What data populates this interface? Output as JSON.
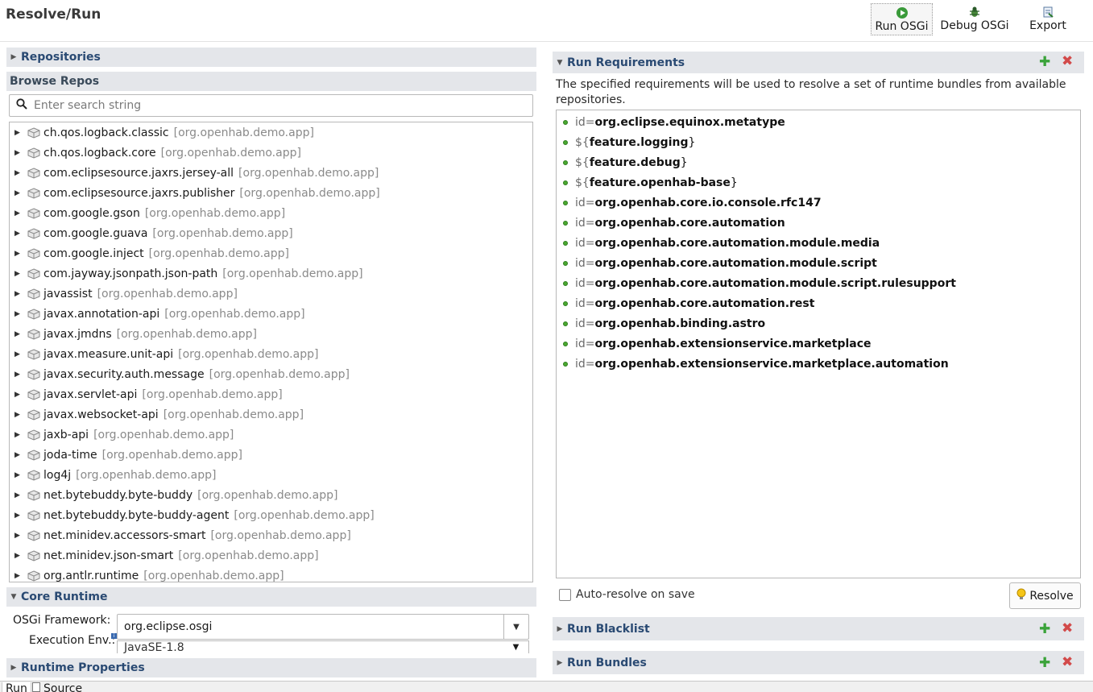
{
  "page": {
    "title": "Resolve/Run"
  },
  "toolbar": {
    "run_label": "Run OSGi",
    "debug_label": "Debug OSGi",
    "export_label": "Export"
  },
  "left": {
    "repositories_label": "Repositories",
    "browse_label": "Browse Repos",
    "search_placeholder": "Enter search string",
    "bundles": [
      {
        "name": "ch.qos.logback.classic",
        "source": "[org.openhab.demo.app]"
      },
      {
        "name": "ch.qos.logback.core",
        "source": "[org.openhab.demo.app]"
      },
      {
        "name": "com.eclipsesource.jaxrs.jersey-all",
        "source": "[org.openhab.demo.app]"
      },
      {
        "name": "com.eclipsesource.jaxrs.publisher",
        "source": "[org.openhab.demo.app]"
      },
      {
        "name": "com.google.gson",
        "source": "[org.openhab.demo.app]"
      },
      {
        "name": "com.google.guava",
        "source": "[org.openhab.demo.app]"
      },
      {
        "name": "com.google.inject",
        "source": "[org.openhab.demo.app]"
      },
      {
        "name": "com.jayway.jsonpath.json-path",
        "source": "[org.openhab.demo.app]"
      },
      {
        "name": "javassist",
        "source": "[org.openhab.demo.app]"
      },
      {
        "name": "javax.annotation-api",
        "source": "[org.openhab.demo.app]"
      },
      {
        "name": "javax.jmdns",
        "source": "[org.openhab.demo.app]"
      },
      {
        "name": "javax.measure.unit-api",
        "source": "[org.openhab.demo.app]"
      },
      {
        "name": "javax.security.auth.message",
        "source": "[org.openhab.demo.app]"
      },
      {
        "name": "javax.servlet-api",
        "source": "[org.openhab.demo.app]"
      },
      {
        "name": "javax.websocket-api",
        "source": "[org.openhab.demo.app]"
      },
      {
        "name": "jaxb-api",
        "source": "[org.openhab.demo.app]"
      },
      {
        "name": "joda-time",
        "source": "[org.openhab.demo.app]"
      },
      {
        "name": "log4j",
        "source": "[org.openhab.demo.app]"
      },
      {
        "name": "net.bytebuddy.byte-buddy",
        "source": "[org.openhab.demo.app]"
      },
      {
        "name": "net.bytebuddy.byte-buddy-agent",
        "source": "[org.openhab.demo.app]"
      },
      {
        "name": "net.minidev.accessors-smart",
        "source": "[org.openhab.demo.app]"
      },
      {
        "name": "net.minidev.json-smart",
        "source": "[org.openhab.demo.app]"
      },
      {
        "name": "org.antlr.runtime",
        "source": "[org.openhab.demo.app]"
      }
    ],
    "core_runtime_label": "Core Runtime",
    "osgi_framework_label": "OSGi Framework:",
    "osgi_framework_value": "org.eclipse.osgi",
    "execution_env_label": "Execution Env.:",
    "execution_env_value": "JavaSE-1.8",
    "runtime_properties_label": "Runtime Properties"
  },
  "right": {
    "run_requirements_label": "Run Requirements",
    "description": "The specified requirements will be used to resolve a set of runtime bundles from available repositories.",
    "requirements": [
      {
        "pre": "id=",
        "value": "org.eclipse.equinox.metatype",
        "post": ""
      },
      {
        "pre": "${",
        "value": "feature.logging",
        "post": "}"
      },
      {
        "pre": "${",
        "value": "feature.debug",
        "post": "}"
      },
      {
        "pre": "${",
        "value": "feature.openhab-base",
        "post": "}"
      },
      {
        "pre": "id=",
        "value": "org.openhab.core.io.console.rfc147",
        "post": ""
      },
      {
        "pre": "id=",
        "value": "org.openhab.core.automation",
        "post": ""
      },
      {
        "pre": "id=",
        "value": "org.openhab.core.automation.module.media",
        "post": ""
      },
      {
        "pre": "id=",
        "value": "org.openhab.core.automation.module.script",
        "post": ""
      },
      {
        "pre": "id=",
        "value": "org.openhab.core.automation.module.script.rulesupport",
        "post": ""
      },
      {
        "pre": "id=",
        "value": "org.openhab.core.automation.rest",
        "post": ""
      },
      {
        "pre": "id=",
        "value": "org.openhab.binding.astro",
        "post": ""
      },
      {
        "pre": "id=",
        "value": "org.openhab.extensionservice.marketplace",
        "post": ""
      },
      {
        "pre": "id=",
        "value": "org.openhab.extensionservice.marketplace.automation",
        "post": ""
      }
    ],
    "auto_resolve_label": "Auto-resolve on save",
    "resolve_label": "Resolve",
    "run_blacklist_label": "Run Blacklist",
    "run_bundles_label": "Run Bundles"
  },
  "tabs": {
    "run": "Run",
    "source": "Source"
  },
  "colors": {
    "section_bg": "#e4e6ea",
    "section_text": "#2a4a73",
    "add": "#3aa33a",
    "remove": "#d24a4a"
  }
}
